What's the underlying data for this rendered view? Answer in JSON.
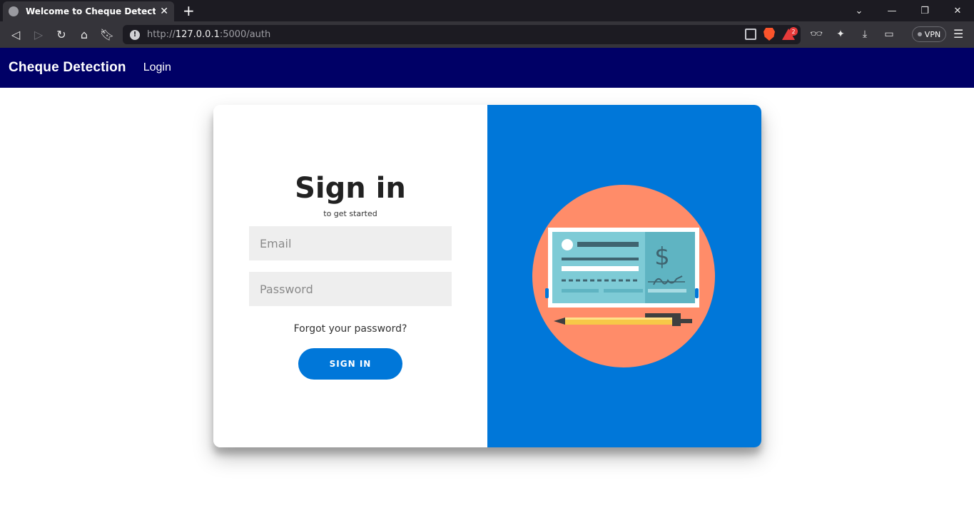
{
  "browser": {
    "tab_title": "Welcome to Cheque Detection Sy",
    "url_prefix": "http://",
    "url_host": "127.0.0.1",
    "url_path": ":5000/auth",
    "rewards_badge": "2",
    "vpn_label": "VPN"
  },
  "navbar": {
    "brand": "Cheque Detection",
    "login_link": "Login",
    "background": "#000066"
  },
  "signin": {
    "title": "Sign in",
    "subtitle": "to get started",
    "email_placeholder": "Email",
    "password_placeholder": "Password",
    "forgot_link": "Forgot your password?",
    "button_label": "SIGN IN",
    "accent": "#0077d9"
  },
  "illustration": {
    "circle_color": "#ff8c69",
    "cheque_color": "#7ecbd6",
    "currency_symbol": "$",
    "pencil_color": "#f7c948"
  }
}
